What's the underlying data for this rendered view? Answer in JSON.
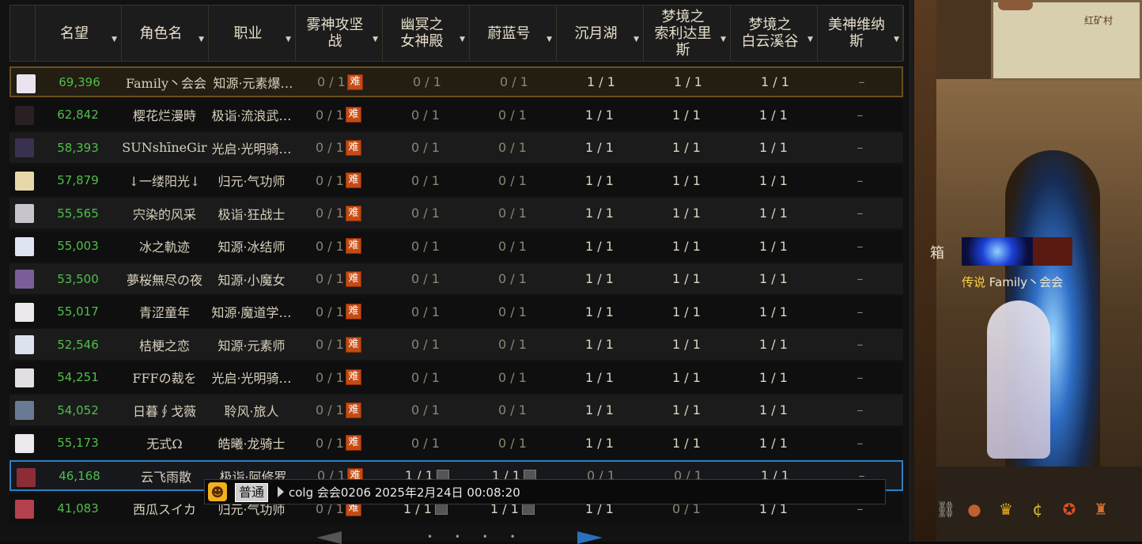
{
  "colors": {
    "fame": "#4fbf4a",
    "hard_badge": "#c44b14",
    "selected_top": "#6b4f1c",
    "selected_blue": "#2f7fc1",
    "header_text": "#e6ddc9"
  },
  "header": [
    {
      "label": "名望"
    },
    {
      "label": "角色名"
    },
    {
      "label": "职业"
    },
    {
      "label": "雾神攻坚\n战"
    },
    {
      "label": "幽冥之\n女神殿"
    },
    {
      "label": "蔚蓝号"
    },
    {
      "label": "沉月湖"
    },
    {
      "label": "梦境之\n索利达里\n斯"
    },
    {
      "label": "梦境之\n白云溪谷"
    },
    {
      "label": "美神维纳\n斯"
    }
  ],
  "hard_badge": "难",
  "rows": [
    {
      "fame": "69,396",
      "name": "Family丶会会",
      "job": "知源·元素爆…",
      "c1": "0 / 1",
      "c2": "0 / 1",
      "c3": "0 / 1",
      "c4": "1 / 1",
      "c5": "1 / 1",
      "c6": "1 / 1",
      "c7": "–"
    },
    {
      "fame": "62,842",
      "name": "樱花烂漫時",
      "job": "极诣·流浪武…",
      "c1": "0 / 1",
      "c2": "0 / 1",
      "c3": "0 / 1",
      "c4": "1 / 1",
      "c5": "1 / 1",
      "c6": "1 / 1",
      "c7": "–"
    },
    {
      "fame": "58,393",
      "name": "SUNshīneGir",
      "job": "光启·光明骑…",
      "c1": "0 / 1",
      "c2": "0 / 1",
      "c3": "0 / 1",
      "c4": "1 / 1",
      "c5": "1 / 1",
      "c6": "1 / 1",
      "c7": "–"
    },
    {
      "fame": "57,879",
      "name": "↓一缕阳光↓",
      "job": "归元·气功师",
      "c1": "0 / 1",
      "c2": "0 / 1",
      "c3": "0 / 1",
      "c4": "1 / 1",
      "c5": "1 / 1",
      "c6": "1 / 1",
      "c7": "–"
    },
    {
      "fame": "55,565",
      "name": "宍染的风采",
      "job": "极诣·狂战士",
      "c1": "0 / 1",
      "c2": "0 / 1",
      "c3": "0 / 1",
      "c4": "1 / 1",
      "c5": "1 / 1",
      "c6": "1 / 1",
      "c7": "–"
    },
    {
      "fame": "55,003",
      "name": "冰之軌迹",
      "job": "知源·冰结师",
      "c1": "0 / 1",
      "c2": "0 / 1",
      "c3": "0 / 1",
      "c4": "1 / 1",
      "c5": "1 / 1",
      "c6": "1 / 1",
      "c7": "–"
    },
    {
      "fame": "53,500",
      "name": "夢桜無尽の夜",
      "job": "知源·小魔女",
      "c1": "0 / 1",
      "c2": "0 / 1",
      "c3": "0 / 1",
      "c4": "1 / 1",
      "c5": "1 / 1",
      "c6": "1 / 1",
      "c7": "–"
    },
    {
      "fame": "55,017",
      "name": "青涩童年",
      "job": "知源·魔道学…",
      "c1": "0 / 1",
      "c2": "0 / 1",
      "c3": "0 / 1",
      "c4": "1 / 1",
      "c5": "1 / 1",
      "c6": "1 / 1",
      "c7": "–"
    },
    {
      "fame": "52,546",
      "name": "桔梗之恋",
      "job": "知源·元素师",
      "c1": "0 / 1",
      "c2": "0 / 1",
      "c3": "0 / 1",
      "c4": "1 / 1",
      "c5": "1 / 1",
      "c6": "1 / 1",
      "c7": "–"
    },
    {
      "fame": "54,251",
      "name": "FFFの裁を",
      "job": "光启·光明骑…",
      "c1": "0 / 1",
      "c2": "0 / 1",
      "c3": "0 / 1",
      "c4": "1 / 1",
      "c5": "1 / 1",
      "c6": "1 / 1",
      "c7": "–"
    },
    {
      "fame": "54,052",
      "name": "日暮∮戈薇",
      "job": "聆风·旅人",
      "c1": "0 / 1",
      "c2": "0 / 1",
      "c3": "0 / 1",
      "c4": "1 / 1",
      "c5": "1 / 1",
      "c6": "1 / 1",
      "c7": "–"
    },
    {
      "fame": "55,173",
      "name": "无式Ω",
      "job": "皓曦·龙骑士",
      "c1": "0 / 1",
      "c2": "0 / 1",
      "c3": "0 / 1",
      "c4": "1 / 1",
      "c5": "1 / 1",
      "c6": "1 / 1",
      "c7": "–"
    },
    {
      "fame": "46,168",
      "name": "云飞雨散",
      "job": "极诣·阿修罗",
      "c1": "0 / 1",
      "c2": "1 / 1",
      "c3": "1 / 1",
      "c4": "0 / 1",
      "c5": "0 / 1",
      "c6": "1 / 1",
      "c7": "–"
    },
    {
      "fame": "41,083",
      "name": "西瓜スイカ",
      "job": "归元·气功师",
      "c1": "0 / 1",
      "c2": "1 / 1",
      "c3": "1 / 1",
      "c4": "1 / 1",
      "c5": "0 / 1",
      "c6": "1 / 1",
      "c7": "–"
    }
  ],
  "chat": {
    "channel": "普通",
    "sender": "colg 会会0206",
    "timestamp": "2025年2月24日 00:08:20"
  },
  "scene": {
    "map_name": "红矿村",
    "box_label": "箱",
    "title_prefix": "传说",
    "player_name": "Family丶会会"
  },
  "avatar_colors": [
    "#e9e4ef",
    "#2a2024",
    "#3a3050",
    "#e8d7a8",
    "#c9c4cc",
    "#dfe4f2",
    "#7a5e9a",
    "#ece9ee",
    "#dde2ef",
    "#e1dfe3",
    "#6a7a95",
    "#ede9ef",
    "#8c2d35",
    "#b3404c"
  ]
}
